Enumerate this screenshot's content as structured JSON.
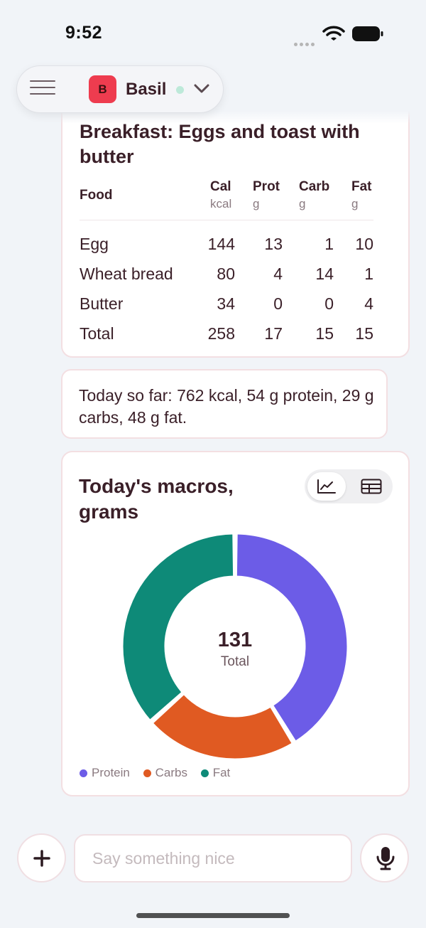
{
  "status_bar": {
    "time": "9:52"
  },
  "header": {
    "app_logo_letter": "B",
    "app_name": "Basil"
  },
  "nutrition_table": {
    "title": "Breakfast: Eggs and toast with butter",
    "columns": [
      {
        "name": "Food",
        "unit": ""
      },
      {
        "name": "Cal",
        "unit": "kcal"
      },
      {
        "name": "Prot",
        "unit": "g"
      },
      {
        "name": "Carb",
        "unit": "g"
      },
      {
        "name": "Fat",
        "unit": "g"
      }
    ],
    "rows": [
      {
        "food": "Egg",
        "cal": "144",
        "prot": "13",
        "carb": "1",
        "fat": "10"
      },
      {
        "food": "Wheat bread",
        "cal": "80",
        "prot": "4",
        "carb": "14",
        "fat": "1"
      },
      {
        "food": "Butter",
        "cal": "34",
        "prot": "0",
        "carb": "0",
        "fat": "4"
      },
      {
        "food": "Total",
        "cal": "258",
        "prot": "17",
        "carb": "15",
        "fat": "15"
      }
    ]
  },
  "summary": {
    "text": "Today so far: 762 kcal, 54 g protein, 29 g carbs, 48 g fat."
  },
  "macros_card": {
    "title": "Today's macros, grams",
    "view_toggle": {
      "chart_icon": "line-chart-icon",
      "table_icon": "table-icon",
      "selected": "chart"
    }
  },
  "chart_data": {
    "type": "pie",
    "title": "Today's macros, grams",
    "categories": [
      "Protein",
      "Carbs",
      "Fat"
    ],
    "values": [
      54,
      29,
      48
    ],
    "colors": [
      "#6c5ce7",
      "#e05a22",
      "#0e8a78"
    ],
    "center_value": "131",
    "center_label": "Total",
    "legend_position": "bottom-left"
  },
  "composer": {
    "placeholder": "Say something nice",
    "add_icon": "plus-icon",
    "mic_icon": "microphone-icon"
  },
  "colors": {
    "background": "#f1f4f8",
    "card_border": "#f3dfe2",
    "text": "#3a1f28",
    "brand": "#ee3c4f"
  }
}
